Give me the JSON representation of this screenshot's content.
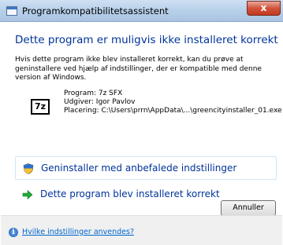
{
  "window": {
    "title": "Programkompatibilitetsassistent",
    "close_label": "x"
  },
  "main": {
    "heading": "Dette program er muligvis ikke installeret korrekt",
    "description": "Hvis dette program ikke blev installeret korrekt, kan du prøve at geninstallere ved hjælp af indstillinger, der er kompatible med denne version af Windows.",
    "app_icon_text": "7z",
    "program": {
      "program_line": "Program: 7z SFX",
      "publisher_line": "Udgiver: Igor Pavlov",
      "location_line": "Placering: C:\\Users\\prrn\\AppData\\...\\greencityinstaller_01.exe"
    },
    "options": [
      {
        "label": "Geninstaller med anbefalede indstillinger",
        "icon": "shield-icon"
      },
      {
        "label": "Dette program blev installeret korrekt",
        "icon": "green-arrow-icon"
      }
    ]
  },
  "footer": {
    "cancel_label": "Annuller",
    "help_link": "Hvilke indstillinger anvendes?"
  },
  "colors": {
    "heading": "#003399",
    "link": "#0066cc",
    "close": "#c03a1f",
    "arrow": "#22a83a"
  }
}
